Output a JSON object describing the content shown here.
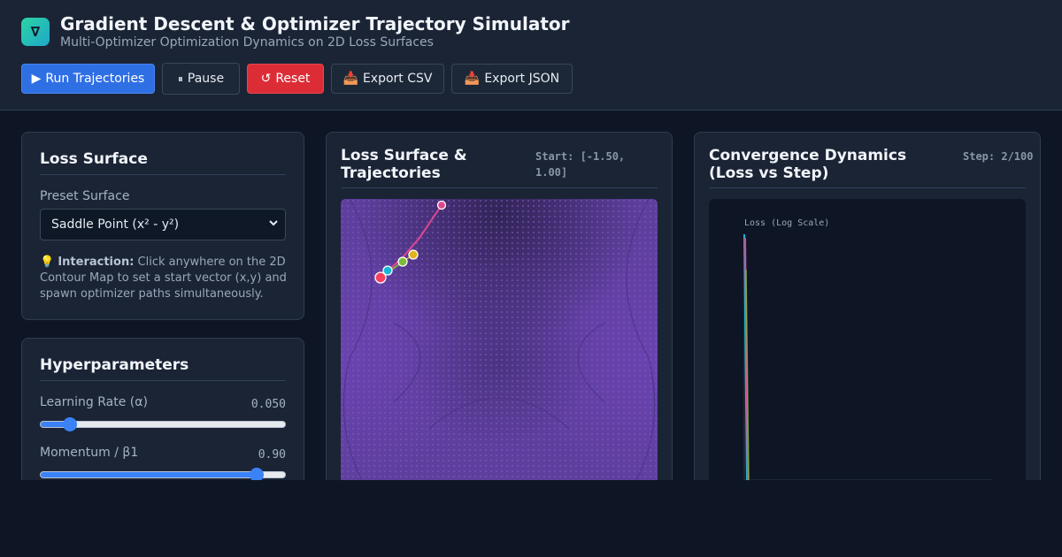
{
  "app": {
    "logo_glyph": "∇",
    "title": "Gradient Descent & Optimizer Trajectory Simulator",
    "subtitle": "Multi-Optimizer Optimization Dynamics on 2D Loss Surfaces"
  },
  "toolbar": {
    "run": {
      "icon": "▶",
      "label": "Run Trajectories"
    },
    "pause": {
      "icon": "⏸",
      "label": "Pause"
    },
    "reset": {
      "icon": "↺",
      "label": "Reset"
    },
    "export_csv": {
      "icon": "📥",
      "label": "Export CSV"
    },
    "export_json": {
      "icon": "📥",
      "label": "Export JSON"
    }
  },
  "loss_surface": {
    "heading": "Loss Surface",
    "preset_label": "Preset Surface",
    "preset_value": "Saddle Point (x² - y²)",
    "hint_icon": "💡",
    "hint_bold": "Interaction:",
    "hint_text": " Click anywhere on the 2D Contour Map to set a start vector (x,y) and spawn optimizer paths simultaneously."
  },
  "hyperparameters": {
    "heading": "Hyperparameters",
    "learning_rate": {
      "label": "Learning Rate (α)",
      "value": "0.050",
      "fraction": 0.12
    },
    "momentum": {
      "label": "Momentum / β1",
      "value": "0.90",
      "fraction": 0.885
    }
  },
  "map_panel": {
    "heading": "Loss Surface & Trajectories",
    "start_label": "Start: [-1.50, 1.00]"
  },
  "conv_panel": {
    "heading": "Convergence Dynamics (Loss vs Step)",
    "step_label": "Step: 2/100",
    "y_axis_label": "Loss (Log Scale)"
  },
  "colors": {
    "accent": "#2f6fe4",
    "danger": "#dc2d36",
    "traj_pink": "#e0468f",
    "traj_cyan": "#17b8d4",
    "traj_green": "#7dbb3c",
    "traj_yellow": "#e2b21f",
    "start_red": "#f43f5e"
  }
}
